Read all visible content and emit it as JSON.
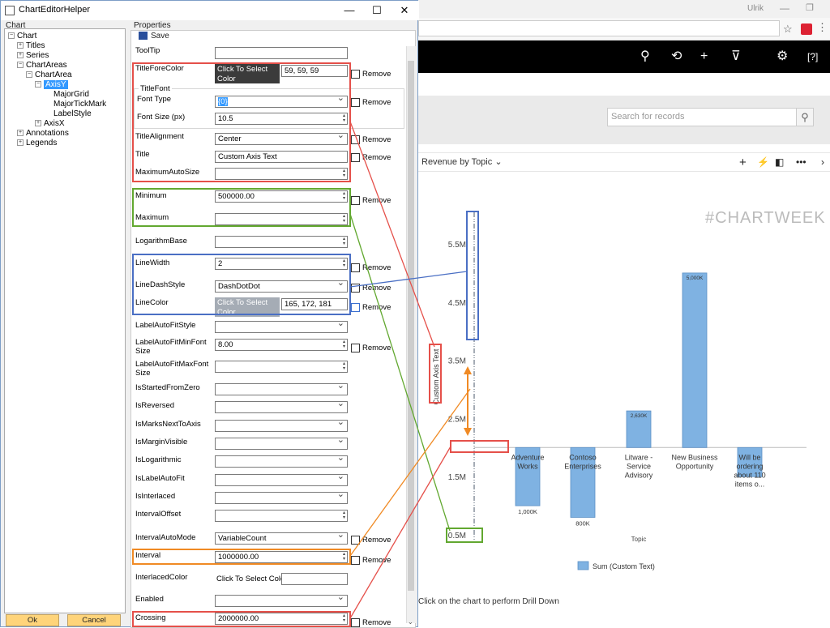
{
  "browser": {
    "user_label": "Ulrik",
    "chart_title": "Revenue by Topic",
    "search_placeholder": "Search for records",
    "watermark": "#CHARTWEEK",
    "drill_hint": "Click on the chart to perform Drill Down"
  },
  "dialog": {
    "title": "ChartEditorHelper",
    "tree_header": "Chart",
    "props_header": "Properties",
    "save_label": "Save",
    "ok_label": "Ok",
    "cancel_label": "Cancel",
    "remove_label": "Remove",
    "tree": [
      {
        "label": "Chart",
        "expander": "−"
      },
      {
        "label": "Titles",
        "expander": "+"
      },
      {
        "label": "Series",
        "expander": "+"
      },
      {
        "label": "ChartAreas",
        "expander": "−"
      },
      {
        "label": "ChartArea",
        "expander": "−"
      },
      {
        "label": "AxisY",
        "expander": "−"
      },
      {
        "label": "MajorGrid",
        "expander": ""
      },
      {
        "label": "MajorTickMark",
        "expander": ""
      },
      {
        "label": "LabelStyle",
        "expander": ""
      },
      {
        "label": "AxisX",
        "expander": "+"
      },
      {
        "label": "Annotations",
        "expander": "+"
      },
      {
        "label": "Legends",
        "expander": "+"
      }
    ],
    "props": {
      "tooltip": {
        "label": "ToolTip",
        "value": ""
      },
      "title_fore_color": {
        "label": "TitleForeColor",
        "button": "Click To Select Color",
        "value": "59, 59, 59",
        "swatch": "#3b3b3b"
      },
      "title_font": {
        "label": "TitleFont"
      },
      "font_type": {
        "label": "Font Type",
        "value": "{0}"
      },
      "font_size": {
        "label": "Font Size (px)",
        "value": "10.5"
      },
      "title_alignment": {
        "label": "TitleAlignment",
        "value": "Center"
      },
      "title": {
        "label": "Title",
        "value": "Custom Axis Text"
      },
      "maximum_auto_size": {
        "label": "MaximumAutoSize",
        "value": ""
      },
      "minimum": {
        "label": "Minimum",
        "value": "500000.00"
      },
      "maximum": {
        "label": "Maximum",
        "value": ""
      },
      "logarithm_base": {
        "label": "LogarithmBase",
        "value": ""
      },
      "line_width": {
        "label": "LineWidth",
        "value": "2"
      },
      "line_dash_style": {
        "label": "LineDashStyle",
        "value": "DashDotDot"
      },
      "line_color": {
        "label": "LineColor",
        "button": "Click To Select Color",
        "value": "165, 172, 181",
        "swatch": "#a5acb5"
      },
      "label_auto_fit_style": {
        "label": "LabelAutoFitStyle",
        "value": ""
      },
      "label_auto_fit_min": {
        "label1": "LabelAutoFitMinFont",
        "label2": "Size",
        "value": "8.00"
      },
      "label_auto_fit_max": {
        "label1": "LabelAutoFitMaxFont",
        "label2": "Size",
        "value": ""
      },
      "is_started_from_zero": {
        "label": "IsStartedFromZero"
      },
      "is_reversed": {
        "label": "IsReversed"
      },
      "is_marks_next_to_axis": {
        "label": "IsMarksNextToAxis"
      },
      "is_margin_visible": {
        "label": "IsMarginVisible"
      },
      "is_logarithmic": {
        "label": "IsLogarithmic"
      },
      "is_label_auto_fit": {
        "label": "IsLabelAutoFit"
      },
      "is_interlaced": {
        "label": "IsInterlaced"
      },
      "interval_offset": {
        "label": "IntervalOffset"
      },
      "interval_auto_mode": {
        "label": "IntervalAutoMode",
        "value": "VariableCount"
      },
      "interval": {
        "label": "Interval",
        "value": "1000000.00"
      },
      "interlaced_color": {
        "label": "InterlacedColor",
        "button": "Click To Select Color"
      },
      "enabled": {
        "label": "Enabled"
      },
      "crossing": {
        "label": "Crossing",
        "value": "2000000.00"
      }
    }
  },
  "colors": {
    "red": "#e5504a",
    "green": "#62a830",
    "blue": "#4a6fc4",
    "orange": "#f08a24",
    "bar": "#7fb2e2"
  },
  "chart_data": {
    "type": "bar",
    "categories": [
      "Adventure Works",
      "Contoso Enterprises",
      "Litware - Service Advisory",
      "New Business Opportunity",
      "Will be ordering about 110 items o..."
    ],
    "category_labels": [
      "Adventure\nWorks",
      "Contoso\nEnterprises",
      "Litware -\nService\nAdvisory",
      "New Business\nOpportunity",
      "Will be\nordering\nabout 110\nitems o..."
    ],
    "values": [
      1000000,
      800000,
      2630000,
      5000000,
      1500000
    ],
    "data_labels": [
      "1,000K",
      "800K",
      "2,630K",
      "5,000K",
      ""
    ],
    "crossing": 2000000,
    "ylim": [
      500000,
      6000000
    ],
    "yticks": [
      500000,
      1500000,
      2500000,
      3500000,
      4500000,
      5500000
    ],
    "ytick_labels": [
      "0.5M",
      "1.5M",
      "2.5M",
      "3.5M",
      "4.5M",
      "5.5M"
    ],
    "ylabel": "Custom Axis Text",
    "xlabel": "Topic",
    "legend": "Sum (Custom Text)",
    "grid": false
  }
}
